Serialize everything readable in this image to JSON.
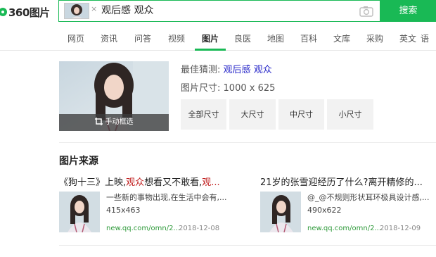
{
  "header": {
    "logo_text": "360图片",
    "query": "观后感 观众",
    "close_glyph": "×",
    "search_button": "搜索",
    "colors": {
      "brand": "#19b955"
    }
  },
  "nav": {
    "items": [
      "网页",
      "资讯",
      "问答",
      "视频",
      "图片",
      "良医",
      "地图",
      "百科",
      "文库",
      "采购",
      "英文",
      "语"
    ],
    "active": "图片"
  },
  "best_guess": {
    "label": "最佳猜测:",
    "guess_parts": [
      "观后感",
      "观众"
    ],
    "size_label": "图片尺寸:",
    "size_value": "1000 x 625",
    "crop_label": "手动框选",
    "size_buttons": [
      "全部尺寸",
      "大尺寸",
      "中尺寸",
      "小尺寸"
    ]
  },
  "sources": {
    "title": "图片来源",
    "cards": [
      {
        "title_pre": "《狗十三》上映,",
        "title_hl": "观众",
        "title_mid": "想看又不敢看,",
        "title_hl2": "观...",
        "desc": "一些新的事物出现,在生活中会有,...",
        "dims": "415x463",
        "url": "new.qq.com/omn/2...",
        "date": "2018-12-08"
      },
      {
        "title_pre": "21岁的张雪迎经历了什么?离开精修的...",
        "title_hl": "",
        "title_mid": "",
        "title_hl2": "",
        "desc": "@_@不规则形状耳环极具设计感,...",
        "dims": "490x622",
        "url": "new.qq.com/omn/2...",
        "date": "2018-12-09"
      }
    ]
  }
}
